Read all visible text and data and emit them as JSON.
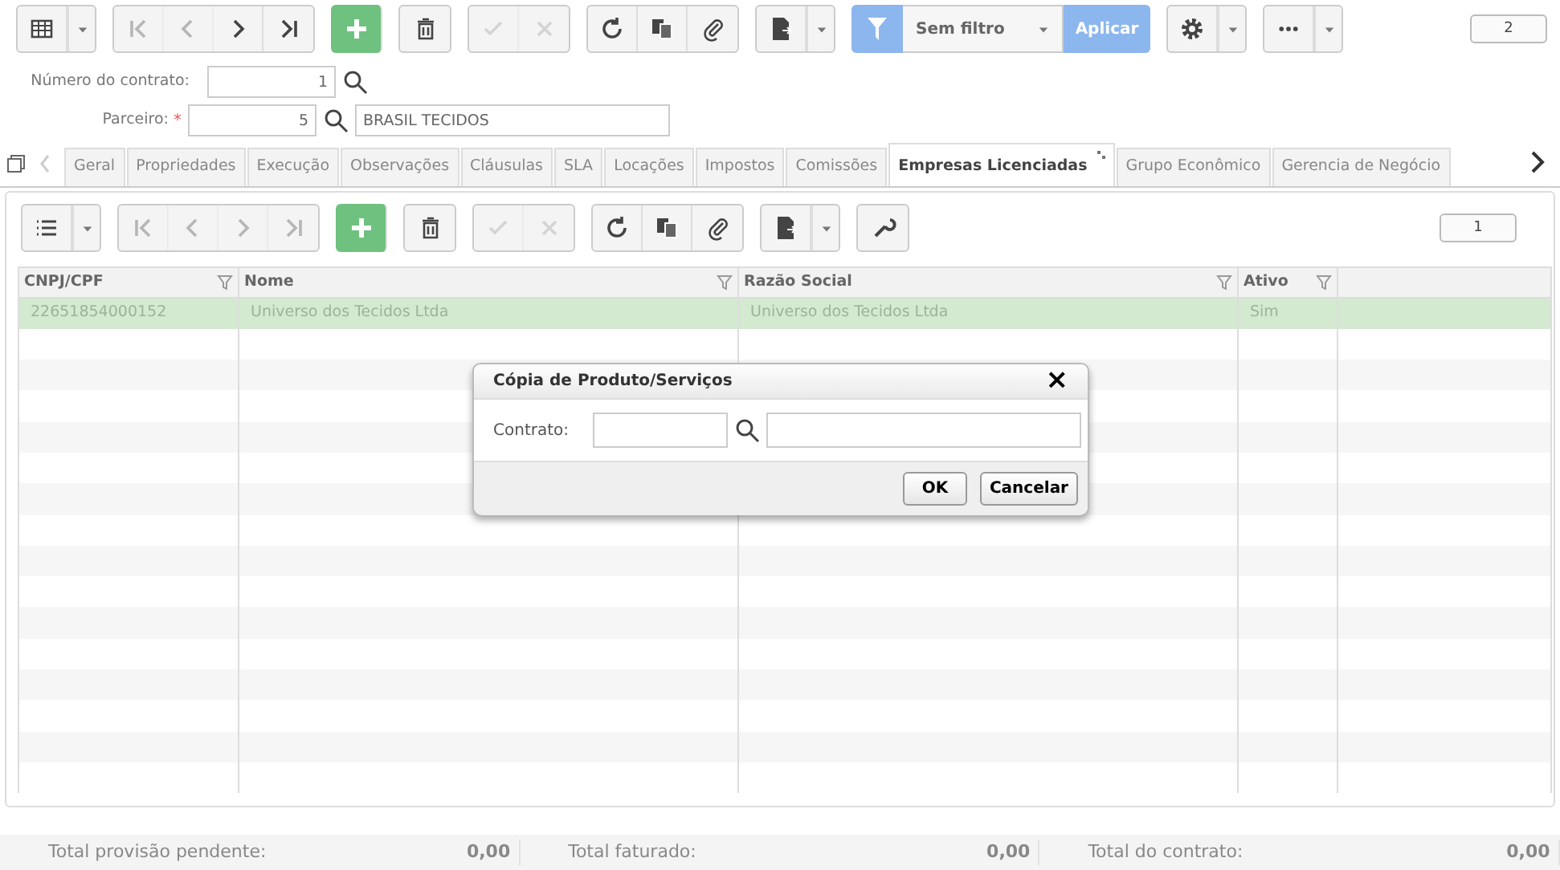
{
  "toolbar": {
    "groups": [
      [
        {
          "kind": "grid",
          "dropdown": true,
          "disabled": false
        }
      ],
      [
        {
          "kind": "first",
          "disabled": true
        },
        {
          "kind": "prev",
          "disabled": true
        },
        {
          "kind": "next",
          "disabled": false
        },
        {
          "kind": "last",
          "disabled": false
        }
      ],
      [
        {
          "kind": "add",
          "disabled": false
        }
      ],
      [
        {
          "kind": "delete",
          "disabled": false
        }
      ],
      [
        {
          "kind": "confirm",
          "disabled": true
        },
        {
          "kind": "cancel",
          "disabled": true
        }
      ],
      [
        {
          "kind": "refresh",
          "disabled": false
        },
        {
          "kind": "copy",
          "disabled": false
        },
        {
          "kind": "attach",
          "disabled": false
        }
      ],
      [
        {
          "kind": "export",
          "dropdown": true,
          "disabled": false
        }
      ]
    ],
    "filter": {
      "value": "Sem filtro",
      "apply": "Aplicar"
    },
    "groups2": [
      [
        {
          "kind": "settings",
          "dropdown": true,
          "disabled": false
        }
      ],
      [
        {
          "kind": "more",
          "dropdown": true,
          "disabled": false
        }
      ]
    ],
    "page": "2"
  },
  "form": {
    "contract": {
      "label": "Número do contrato:",
      "value": "1"
    },
    "partner": {
      "label": "Parceiro:",
      "required_mark": "*",
      "value": "5",
      "name": "BRASIL TECIDOS"
    }
  },
  "tabs": [
    {
      "label": "Geral",
      "selected": false
    },
    {
      "label": "Propriedades",
      "selected": false
    },
    {
      "label": "Execução",
      "selected": false
    },
    {
      "label": "Observações",
      "selected": false
    },
    {
      "label": "Cláusulas",
      "selected": false
    },
    {
      "label": "SLA",
      "selected": false
    },
    {
      "label": "Locações",
      "selected": false
    },
    {
      "label": "Impostos",
      "selected": false
    },
    {
      "label": "Comissões",
      "selected": false
    },
    {
      "label": "Empresas Licenciadas",
      "selected": true
    },
    {
      "label": "Grupo Econômico",
      "selected": false
    },
    {
      "label": "Gerencia de Negócio",
      "selected": false
    }
  ],
  "subtoolbar": {
    "groups": [
      [
        {
          "kind": "list",
          "dropdown": true,
          "disabled": false
        }
      ],
      [
        {
          "kind": "first",
          "disabled": true
        },
        {
          "kind": "prev",
          "disabled": true
        },
        {
          "kind": "next",
          "disabled": true
        },
        {
          "kind": "last",
          "disabled": true
        }
      ],
      [
        {
          "kind": "add",
          "disabled": false
        }
      ],
      [
        {
          "kind": "delete",
          "disabled": false
        }
      ],
      [
        {
          "kind": "confirm",
          "disabled": true
        },
        {
          "kind": "cancel",
          "disabled": true
        }
      ],
      [
        {
          "kind": "refresh",
          "disabled": false
        },
        {
          "kind": "copy",
          "disabled": false
        },
        {
          "kind": "attach",
          "disabled": false
        }
      ],
      [
        {
          "kind": "export",
          "dropdown": true,
          "disabled": false
        }
      ],
      [
        {
          "kind": "tool",
          "disabled": false
        }
      ]
    ],
    "page": "1"
  },
  "table": {
    "columns": [
      "CNPJ/CPF",
      "Nome",
      "Razão Social",
      "Ativo"
    ],
    "rows": [
      {
        "cells": [
          "22651854000152",
          "Universo dos Tecidos Ltda",
          "Universo dos Tecidos Ltda",
          "Sim"
        ],
        "selected": true
      }
    ]
  },
  "dialog": {
    "title": "Cópia de Produto/Serviços",
    "close": "×",
    "field_label": "Contrato:",
    "buttons": [
      "OK",
      "Cancelar"
    ]
  },
  "totals": [
    {
      "label": "Total provisão pendente:",
      "value": "0,00"
    },
    {
      "label": "Total faturado:",
      "value": "0,00"
    },
    {
      "label": "Total do contrato:",
      "value": "0,00"
    }
  ]
}
